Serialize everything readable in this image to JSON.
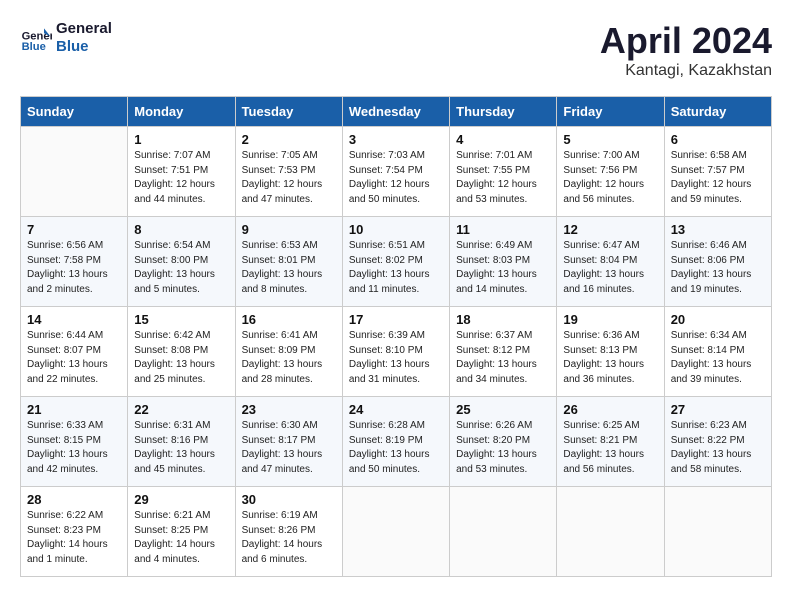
{
  "logo": {
    "line1": "General",
    "line2": "Blue"
  },
  "title": "April 2024",
  "subtitle": "Kantagi, Kazakhstan",
  "weekdays": [
    "Sunday",
    "Monday",
    "Tuesday",
    "Wednesday",
    "Thursday",
    "Friday",
    "Saturday"
  ],
  "weeks": [
    [
      {
        "day": "",
        "info": ""
      },
      {
        "day": "1",
        "info": "Sunrise: 7:07 AM\nSunset: 7:51 PM\nDaylight: 12 hours\nand 44 minutes."
      },
      {
        "day": "2",
        "info": "Sunrise: 7:05 AM\nSunset: 7:53 PM\nDaylight: 12 hours\nand 47 minutes."
      },
      {
        "day": "3",
        "info": "Sunrise: 7:03 AM\nSunset: 7:54 PM\nDaylight: 12 hours\nand 50 minutes."
      },
      {
        "day": "4",
        "info": "Sunrise: 7:01 AM\nSunset: 7:55 PM\nDaylight: 12 hours\nand 53 minutes."
      },
      {
        "day": "5",
        "info": "Sunrise: 7:00 AM\nSunset: 7:56 PM\nDaylight: 12 hours\nand 56 minutes."
      },
      {
        "day": "6",
        "info": "Sunrise: 6:58 AM\nSunset: 7:57 PM\nDaylight: 12 hours\nand 59 minutes."
      }
    ],
    [
      {
        "day": "7",
        "info": "Sunrise: 6:56 AM\nSunset: 7:58 PM\nDaylight: 13 hours\nand 2 minutes."
      },
      {
        "day": "8",
        "info": "Sunrise: 6:54 AM\nSunset: 8:00 PM\nDaylight: 13 hours\nand 5 minutes."
      },
      {
        "day": "9",
        "info": "Sunrise: 6:53 AM\nSunset: 8:01 PM\nDaylight: 13 hours\nand 8 minutes."
      },
      {
        "day": "10",
        "info": "Sunrise: 6:51 AM\nSunset: 8:02 PM\nDaylight: 13 hours\nand 11 minutes."
      },
      {
        "day": "11",
        "info": "Sunrise: 6:49 AM\nSunset: 8:03 PM\nDaylight: 13 hours\nand 14 minutes."
      },
      {
        "day": "12",
        "info": "Sunrise: 6:47 AM\nSunset: 8:04 PM\nDaylight: 13 hours\nand 16 minutes."
      },
      {
        "day": "13",
        "info": "Sunrise: 6:46 AM\nSunset: 8:06 PM\nDaylight: 13 hours\nand 19 minutes."
      }
    ],
    [
      {
        "day": "14",
        "info": "Sunrise: 6:44 AM\nSunset: 8:07 PM\nDaylight: 13 hours\nand 22 minutes."
      },
      {
        "day": "15",
        "info": "Sunrise: 6:42 AM\nSunset: 8:08 PM\nDaylight: 13 hours\nand 25 minutes."
      },
      {
        "day": "16",
        "info": "Sunrise: 6:41 AM\nSunset: 8:09 PM\nDaylight: 13 hours\nand 28 minutes."
      },
      {
        "day": "17",
        "info": "Sunrise: 6:39 AM\nSunset: 8:10 PM\nDaylight: 13 hours\nand 31 minutes."
      },
      {
        "day": "18",
        "info": "Sunrise: 6:37 AM\nSunset: 8:12 PM\nDaylight: 13 hours\nand 34 minutes."
      },
      {
        "day": "19",
        "info": "Sunrise: 6:36 AM\nSunset: 8:13 PM\nDaylight: 13 hours\nand 36 minutes."
      },
      {
        "day": "20",
        "info": "Sunrise: 6:34 AM\nSunset: 8:14 PM\nDaylight: 13 hours\nand 39 minutes."
      }
    ],
    [
      {
        "day": "21",
        "info": "Sunrise: 6:33 AM\nSunset: 8:15 PM\nDaylight: 13 hours\nand 42 minutes."
      },
      {
        "day": "22",
        "info": "Sunrise: 6:31 AM\nSunset: 8:16 PM\nDaylight: 13 hours\nand 45 minutes."
      },
      {
        "day": "23",
        "info": "Sunrise: 6:30 AM\nSunset: 8:17 PM\nDaylight: 13 hours\nand 47 minutes."
      },
      {
        "day": "24",
        "info": "Sunrise: 6:28 AM\nSunset: 8:19 PM\nDaylight: 13 hours\nand 50 minutes."
      },
      {
        "day": "25",
        "info": "Sunrise: 6:26 AM\nSunset: 8:20 PM\nDaylight: 13 hours\nand 53 minutes."
      },
      {
        "day": "26",
        "info": "Sunrise: 6:25 AM\nSunset: 8:21 PM\nDaylight: 13 hours\nand 56 minutes."
      },
      {
        "day": "27",
        "info": "Sunrise: 6:23 AM\nSunset: 8:22 PM\nDaylight: 13 hours\nand 58 minutes."
      }
    ],
    [
      {
        "day": "28",
        "info": "Sunrise: 6:22 AM\nSunset: 8:23 PM\nDaylight: 14 hours\nand 1 minute."
      },
      {
        "day": "29",
        "info": "Sunrise: 6:21 AM\nSunset: 8:25 PM\nDaylight: 14 hours\nand 4 minutes."
      },
      {
        "day": "30",
        "info": "Sunrise: 6:19 AM\nSunset: 8:26 PM\nDaylight: 14 hours\nand 6 minutes."
      },
      {
        "day": "",
        "info": ""
      },
      {
        "day": "",
        "info": ""
      },
      {
        "day": "",
        "info": ""
      },
      {
        "day": "",
        "info": ""
      }
    ]
  ]
}
